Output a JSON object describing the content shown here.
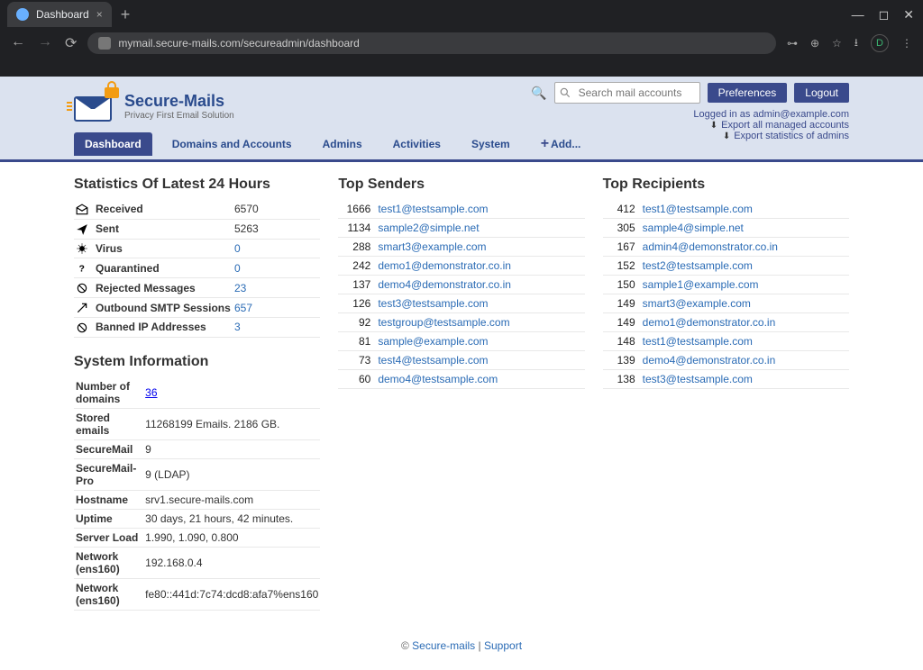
{
  "browser": {
    "tab_title": "Dashboard",
    "url": "mymail.secure-mails.com/secureadmin/dashboard",
    "profile_letter": "D"
  },
  "header": {
    "search_placeholder": "Search mail accounts",
    "preferences": "Preferences",
    "logout": "Logout",
    "logged_in_as": "Logged in as admin@example.com",
    "export_accounts": "Export all managed accounts",
    "export_admins": "Export statistics of admins",
    "logo_big": "Secure-Mails",
    "logo_small": "Privacy First Email Solution"
  },
  "nav": {
    "dashboard": "Dashboard",
    "domains": "Domains and Accounts",
    "admins": "Admins",
    "activities": "Activities",
    "system": "System",
    "add": "Add..."
  },
  "stats": {
    "heading": "Statistics Of Latest 24 Hours",
    "rows": {
      "received": {
        "label": "Received",
        "value": "6570"
      },
      "sent": {
        "label": "Sent",
        "value": "5263"
      },
      "virus": {
        "label": "Virus",
        "value": "0"
      },
      "quarantined": {
        "label": "Quarantined",
        "value": "0"
      },
      "rejected": {
        "label": "Rejected Messages",
        "value": "23"
      },
      "outbound": {
        "label": "Outbound SMTP Sessions",
        "value": "657"
      },
      "banned": {
        "label": "Banned IP Addresses",
        "value": "3"
      }
    }
  },
  "sysinfo": {
    "heading": "System Information",
    "rows": {
      "domains": {
        "label": "Number of domains",
        "value": "36"
      },
      "stored": {
        "label": "Stored emails",
        "value": "11268199 Emails. 2186 GB."
      },
      "sm": {
        "label": "SecureMail",
        "value": "9"
      },
      "smpro": {
        "label": "SecureMail-Pro",
        "value": "9 (LDAP)"
      },
      "hostname": {
        "label": "Hostname",
        "value": "srv1.secure-mails.com"
      },
      "uptime": {
        "label": "Uptime",
        "value": "30 days, 21 hours, 42 minutes."
      },
      "load": {
        "label": "Server Load",
        "value": "1.990, 1.090, 0.800"
      },
      "net1": {
        "label": "Network (ens160)",
        "value": "192.168.0.4"
      },
      "net2": {
        "label": "Network (ens160)",
        "value": "fe80::441d:7c74:dcd8:afa7%ens160"
      }
    }
  },
  "top_senders": {
    "heading": "Top Senders",
    "items": [
      {
        "count": "1666",
        "addr": "test1@testsample.com"
      },
      {
        "count": "1134",
        "addr": "sample2@simple.net"
      },
      {
        "count": "288",
        "addr": "smart3@example.com"
      },
      {
        "count": "242",
        "addr": "demo1@demonstrator.co.in"
      },
      {
        "count": "137",
        "addr": "demo4@demonstrator.co.in"
      },
      {
        "count": "126",
        "addr": "test3@testsample.com"
      },
      {
        "count": "92",
        "addr": "testgroup@testsample.com"
      },
      {
        "count": "81",
        "addr": "sample@example.com"
      },
      {
        "count": "73",
        "addr": "test4@testsample.com"
      },
      {
        "count": "60",
        "addr": "demo4@testsample.com"
      }
    ]
  },
  "top_recipients": {
    "heading": "Top Recipients",
    "items": [
      {
        "count": "412",
        "addr": "test1@testsample.com"
      },
      {
        "count": "305",
        "addr": "sample4@simple.net"
      },
      {
        "count": "167",
        "addr": "admin4@demonstrator.co.in"
      },
      {
        "count": "152",
        "addr": "test2@testsample.com"
      },
      {
        "count": "150",
        "addr": "sample1@example.com"
      },
      {
        "count": "149",
        "addr": "smart3@example.com"
      },
      {
        "count": "149",
        "addr": "demo1@demonstrator.co.in"
      },
      {
        "count": "148",
        "addr": "test1@testsample.com"
      },
      {
        "count": "139",
        "addr": "demo4@demonstrator.co.in"
      },
      {
        "count": "138",
        "addr": "test3@testsample.com"
      }
    ]
  },
  "footer": {
    "copy": "©",
    "brand": "Secure-mails",
    "sep": "|",
    "support": "Support"
  }
}
